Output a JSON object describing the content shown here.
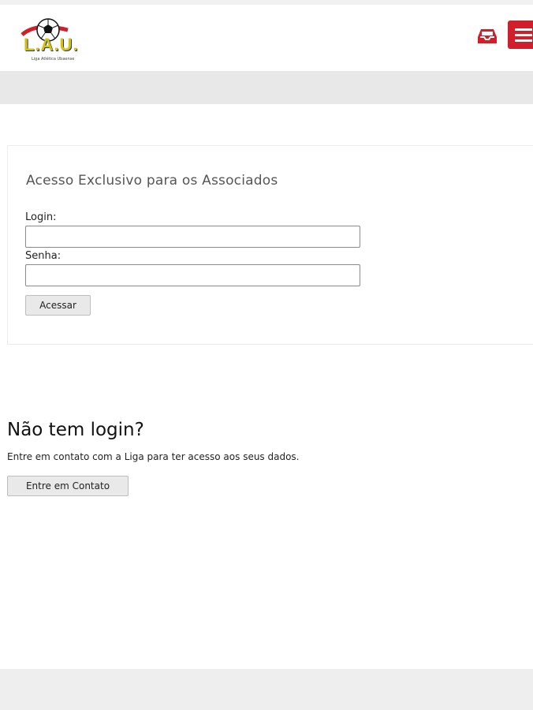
{
  "header": {
    "logo_text": "L.A.U.",
    "logo_subtitle": "Liga Atlética Ubaense",
    "colors": {
      "accent": "#d01f2b",
      "logo_yellow": "#d7c10b"
    },
    "icons": [
      "inbox-icon",
      "menu-icon"
    ]
  },
  "login": {
    "title": "Acesso Exclusivo para os Associados",
    "login_label": "Login:",
    "login_value": "",
    "senha_label": "Senha:",
    "senha_value": "",
    "submit_label": "Acessar"
  },
  "no_login": {
    "title": "Não tem login?",
    "text": "Entre em contato com a Liga para ter acesso aos seus dados.",
    "button_label": "Entre em Contato"
  }
}
